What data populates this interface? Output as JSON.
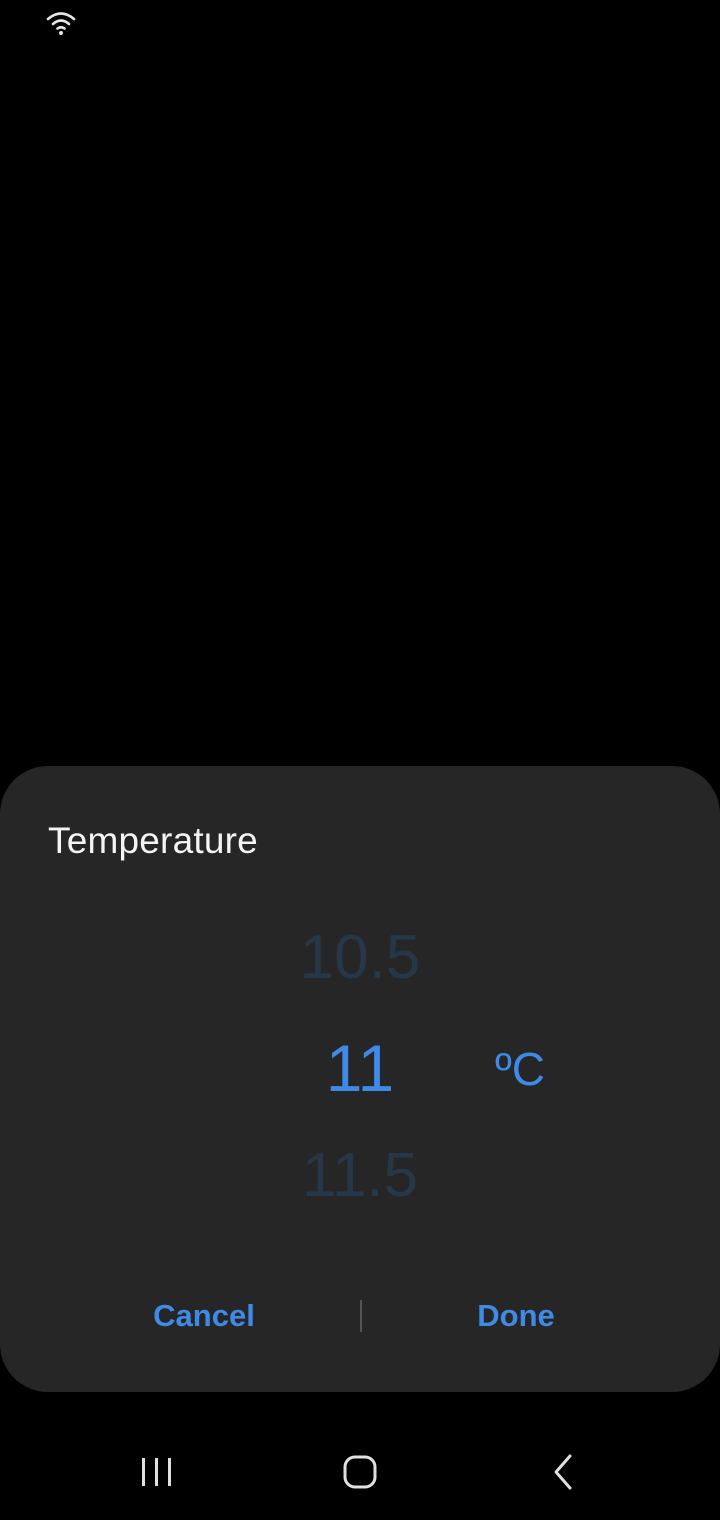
{
  "status_bar": {
    "wifi_icon": "wifi-icon"
  },
  "dialog": {
    "title": "Temperature",
    "picker": {
      "previous_value": "10.5",
      "selected_value": "11",
      "next_value": "11.5",
      "unit": "ºC"
    },
    "buttons": {
      "cancel_label": "Cancel",
      "done_label": "Done"
    }
  },
  "nav_bar": {
    "recents_icon": "recents-icon",
    "home_icon": "home-icon",
    "back_icon": "back-icon"
  },
  "colors": {
    "background": "#000000",
    "dialog_background": "#262626",
    "accent": "#3f8ae6",
    "dim_value": "#263748",
    "title_text": "#f4f4f4"
  }
}
